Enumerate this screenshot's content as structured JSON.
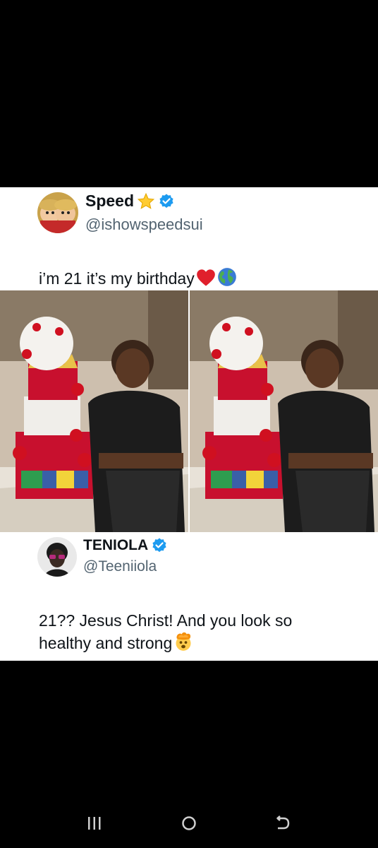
{
  "tweets": [
    {
      "display_name": "Speed",
      "handle": "@ishowspeedsui",
      "text": "i’m 21 it’s my birthday",
      "verified": true,
      "photo_count": 2
    },
    {
      "display_name": "TENIOLA",
      "handle": "@Teeniiola",
      "text_line1": "21?? Jesus Christ! And you look so",
      "text_line2": "healthy and strong",
      "verified": true
    }
  ],
  "icons": {
    "verified": "verified-badge-icon",
    "star": "star-emoji-icon",
    "heart": "red-heart-emoji-icon",
    "globe": "globe-emoji-icon",
    "mind_blown": "exploding-head-emoji-icon",
    "nav_recents": "recents-icon",
    "nav_home": "home-icon",
    "nav_back": "back-icon"
  },
  "colors": {
    "background": "#000000",
    "card": "#ffffff",
    "text": "#0f1419",
    "secondary_text": "#536471",
    "verified": "#1d9bf0",
    "nav_icons": "#cfcfcf"
  }
}
